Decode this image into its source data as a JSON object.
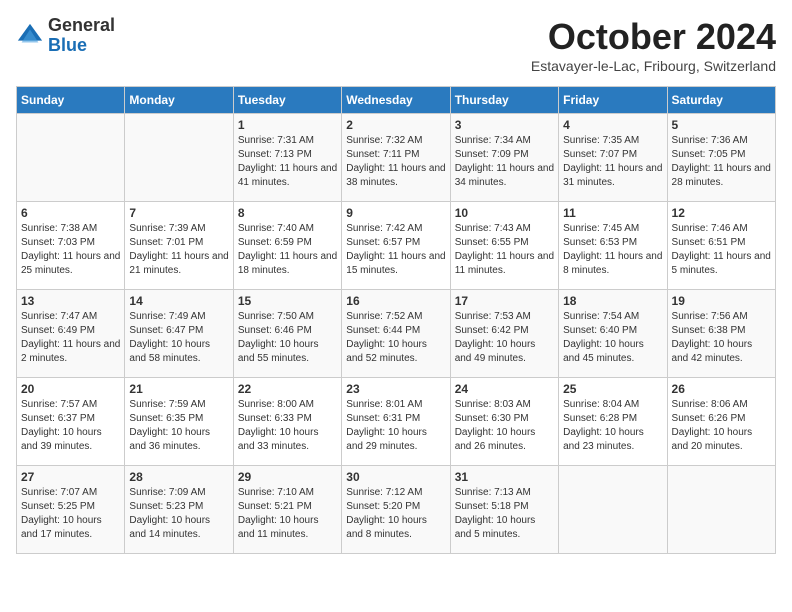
{
  "logo": {
    "general": "General",
    "blue": "Blue"
  },
  "header": {
    "month": "October 2024",
    "location": "Estavayer-le-Lac, Fribourg, Switzerland"
  },
  "days_header": [
    "Sunday",
    "Monday",
    "Tuesday",
    "Wednesday",
    "Thursday",
    "Friday",
    "Saturday"
  ],
  "weeks": [
    [
      {
        "day": "",
        "sunrise": "",
        "sunset": "",
        "daylight": ""
      },
      {
        "day": "",
        "sunrise": "",
        "sunset": "",
        "daylight": ""
      },
      {
        "day": "1",
        "sunrise": "Sunrise: 7:31 AM",
        "sunset": "Sunset: 7:13 PM",
        "daylight": "Daylight: 11 hours and 41 minutes."
      },
      {
        "day": "2",
        "sunrise": "Sunrise: 7:32 AM",
        "sunset": "Sunset: 7:11 PM",
        "daylight": "Daylight: 11 hours and 38 minutes."
      },
      {
        "day": "3",
        "sunrise": "Sunrise: 7:34 AM",
        "sunset": "Sunset: 7:09 PM",
        "daylight": "Daylight: 11 hours and 34 minutes."
      },
      {
        "day": "4",
        "sunrise": "Sunrise: 7:35 AM",
        "sunset": "Sunset: 7:07 PM",
        "daylight": "Daylight: 11 hours and 31 minutes."
      },
      {
        "day": "5",
        "sunrise": "Sunrise: 7:36 AM",
        "sunset": "Sunset: 7:05 PM",
        "daylight": "Daylight: 11 hours and 28 minutes."
      }
    ],
    [
      {
        "day": "6",
        "sunrise": "Sunrise: 7:38 AM",
        "sunset": "Sunset: 7:03 PM",
        "daylight": "Daylight: 11 hours and 25 minutes."
      },
      {
        "day": "7",
        "sunrise": "Sunrise: 7:39 AM",
        "sunset": "Sunset: 7:01 PM",
        "daylight": "Daylight: 11 hours and 21 minutes."
      },
      {
        "day": "8",
        "sunrise": "Sunrise: 7:40 AM",
        "sunset": "Sunset: 6:59 PM",
        "daylight": "Daylight: 11 hours and 18 minutes."
      },
      {
        "day": "9",
        "sunrise": "Sunrise: 7:42 AM",
        "sunset": "Sunset: 6:57 PM",
        "daylight": "Daylight: 11 hours and 15 minutes."
      },
      {
        "day": "10",
        "sunrise": "Sunrise: 7:43 AM",
        "sunset": "Sunset: 6:55 PM",
        "daylight": "Daylight: 11 hours and 11 minutes."
      },
      {
        "day": "11",
        "sunrise": "Sunrise: 7:45 AM",
        "sunset": "Sunset: 6:53 PM",
        "daylight": "Daylight: 11 hours and 8 minutes."
      },
      {
        "day": "12",
        "sunrise": "Sunrise: 7:46 AM",
        "sunset": "Sunset: 6:51 PM",
        "daylight": "Daylight: 11 hours and 5 minutes."
      }
    ],
    [
      {
        "day": "13",
        "sunrise": "Sunrise: 7:47 AM",
        "sunset": "Sunset: 6:49 PM",
        "daylight": "Daylight: 11 hours and 2 minutes."
      },
      {
        "day": "14",
        "sunrise": "Sunrise: 7:49 AM",
        "sunset": "Sunset: 6:47 PM",
        "daylight": "Daylight: 10 hours and 58 minutes."
      },
      {
        "day": "15",
        "sunrise": "Sunrise: 7:50 AM",
        "sunset": "Sunset: 6:46 PM",
        "daylight": "Daylight: 10 hours and 55 minutes."
      },
      {
        "day": "16",
        "sunrise": "Sunrise: 7:52 AM",
        "sunset": "Sunset: 6:44 PM",
        "daylight": "Daylight: 10 hours and 52 minutes."
      },
      {
        "day": "17",
        "sunrise": "Sunrise: 7:53 AM",
        "sunset": "Sunset: 6:42 PM",
        "daylight": "Daylight: 10 hours and 49 minutes."
      },
      {
        "day": "18",
        "sunrise": "Sunrise: 7:54 AM",
        "sunset": "Sunset: 6:40 PM",
        "daylight": "Daylight: 10 hours and 45 minutes."
      },
      {
        "day": "19",
        "sunrise": "Sunrise: 7:56 AM",
        "sunset": "Sunset: 6:38 PM",
        "daylight": "Daylight: 10 hours and 42 minutes."
      }
    ],
    [
      {
        "day": "20",
        "sunrise": "Sunrise: 7:57 AM",
        "sunset": "Sunset: 6:37 PM",
        "daylight": "Daylight: 10 hours and 39 minutes."
      },
      {
        "day": "21",
        "sunrise": "Sunrise: 7:59 AM",
        "sunset": "Sunset: 6:35 PM",
        "daylight": "Daylight: 10 hours and 36 minutes."
      },
      {
        "day": "22",
        "sunrise": "Sunrise: 8:00 AM",
        "sunset": "Sunset: 6:33 PM",
        "daylight": "Daylight: 10 hours and 33 minutes."
      },
      {
        "day": "23",
        "sunrise": "Sunrise: 8:01 AM",
        "sunset": "Sunset: 6:31 PM",
        "daylight": "Daylight: 10 hours and 29 minutes."
      },
      {
        "day": "24",
        "sunrise": "Sunrise: 8:03 AM",
        "sunset": "Sunset: 6:30 PM",
        "daylight": "Daylight: 10 hours and 26 minutes."
      },
      {
        "day": "25",
        "sunrise": "Sunrise: 8:04 AM",
        "sunset": "Sunset: 6:28 PM",
        "daylight": "Daylight: 10 hours and 23 minutes."
      },
      {
        "day": "26",
        "sunrise": "Sunrise: 8:06 AM",
        "sunset": "Sunset: 6:26 PM",
        "daylight": "Daylight: 10 hours and 20 minutes."
      }
    ],
    [
      {
        "day": "27",
        "sunrise": "Sunrise: 7:07 AM",
        "sunset": "Sunset: 5:25 PM",
        "daylight": "Daylight: 10 hours and 17 minutes."
      },
      {
        "day": "28",
        "sunrise": "Sunrise: 7:09 AM",
        "sunset": "Sunset: 5:23 PM",
        "daylight": "Daylight: 10 hours and 14 minutes."
      },
      {
        "day": "29",
        "sunrise": "Sunrise: 7:10 AM",
        "sunset": "Sunset: 5:21 PM",
        "daylight": "Daylight: 10 hours and 11 minutes."
      },
      {
        "day": "30",
        "sunrise": "Sunrise: 7:12 AM",
        "sunset": "Sunset: 5:20 PM",
        "daylight": "Daylight: 10 hours and 8 minutes."
      },
      {
        "day": "31",
        "sunrise": "Sunrise: 7:13 AM",
        "sunset": "Sunset: 5:18 PM",
        "daylight": "Daylight: 10 hours and 5 minutes."
      },
      {
        "day": "",
        "sunrise": "",
        "sunset": "",
        "daylight": ""
      },
      {
        "day": "",
        "sunrise": "",
        "sunset": "",
        "daylight": ""
      }
    ]
  ]
}
